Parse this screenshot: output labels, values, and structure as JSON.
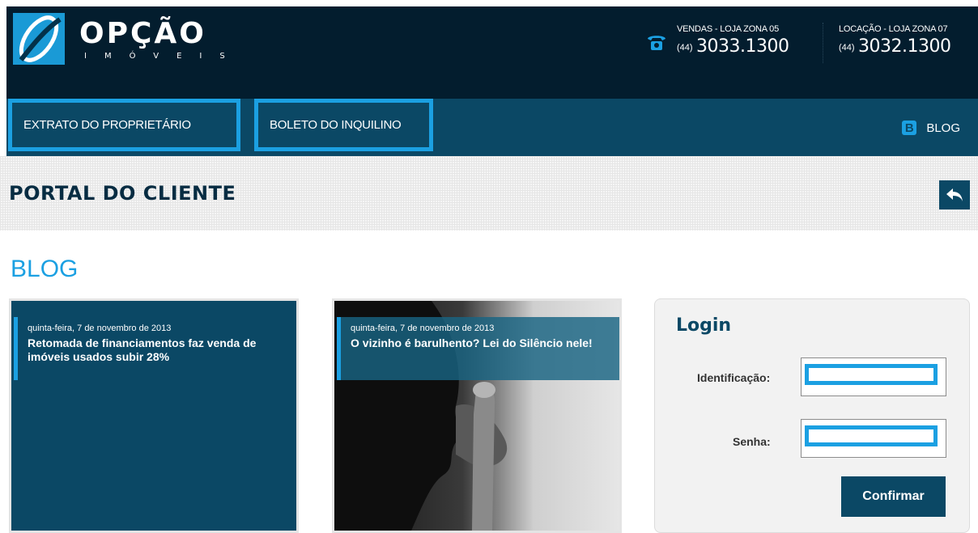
{
  "header": {
    "brand_name": "OPÇÃO",
    "brand_sub": "IMÓVEIS",
    "sales": {
      "label": "VENDAS - LOJA ZONA 05",
      "ddd": "(44)",
      "number": "3033.1300"
    },
    "rent": {
      "label": "LOCAÇÃO - LOJA ZONA 07",
      "ddd": "(44)",
      "number": "3032.1300"
    }
  },
  "nav": {
    "items": [
      {
        "label": "EXTRATO DO PROPRIETÁRIO"
      },
      {
        "label": "BOLETO DO INQUILINO"
      }
    ],
    "blog_label": "BLOG"
  },
  "page": {
    "title": "PORTAL DO CLIENTE"
  },
  "blog": {
    "heading": "BLOG",
    "posts": [
      {
        "date": "quinta-feira, 7 de novembro de 2013",
        "title": "Retomada de financiamentos faz venda de imóveis usados subir 28%"
      },
      {
        "date": "quinta-feira, 7 de novembro de 2013",
        "title": "O vizinho é barulhento? Lei do Silêncio nele!"
      }
    ]
  },
  "login": {
    "title": "Login",
    "id_label": "Identificação:",
    "id_value": "",
    "password_label": "Senha:",
    "password_value": "",
    "confirm_label": "Confirmar"
  },
  "colors": {
    "header_bg": "#031d2e",
    "nav_bg": "#0b4865",
    "accent": "#1ba0e2",
    "title_text": "#072c42"
  },
  "icons": [
    "logo-icon",
    "phone-icon",
    "blogger-icon",
    "back-arrow-icon"
  ]
}
